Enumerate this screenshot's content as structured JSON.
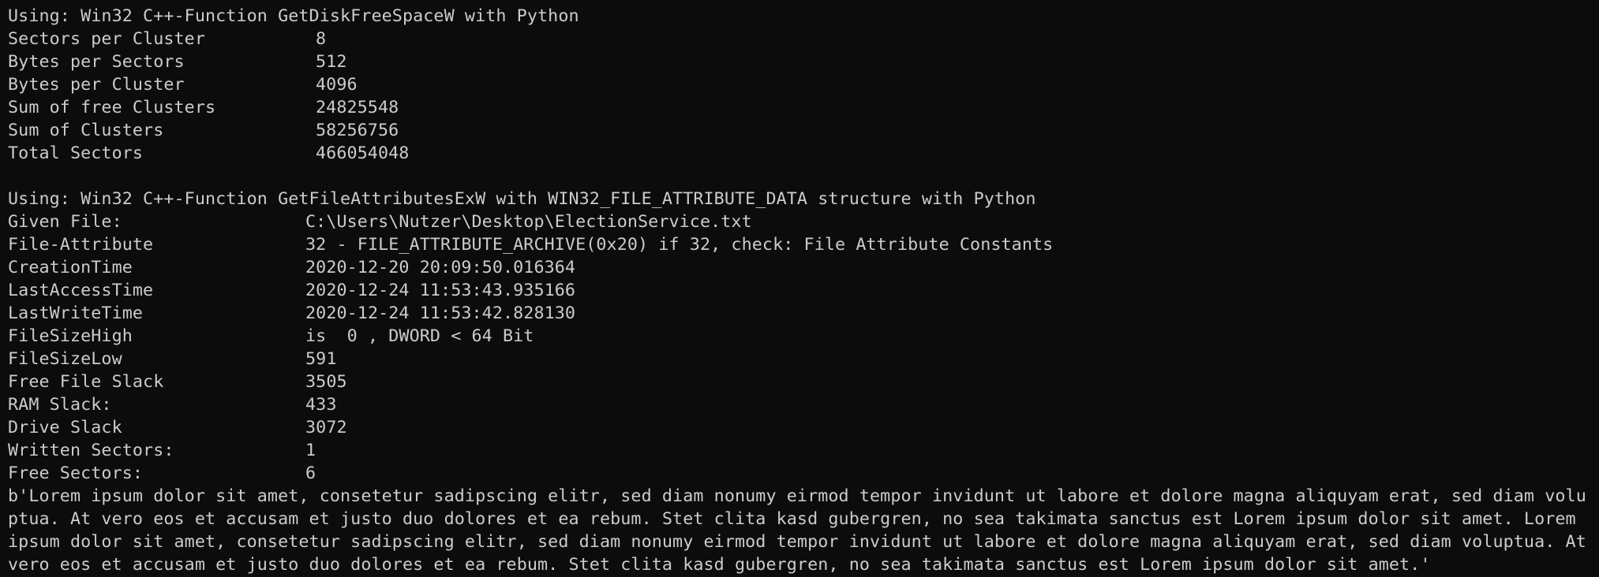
{
  "section1": {
    "heading": "Using: Win32 C++-Function GetDiskFreeSpaceW with Python",
    "rows": [
      {
        "label": "Sectors per Cluster",
        "value": "8"
      },
      {
        "label": "Bytes per Sectors",
        "value": "512"
      },
      {
        "label": "Bytes per Cluster",
        "value": "4096"
      },
      {
        "label": "Sum of free Clusters",
        "value": "24825548"
      },
      {
        "label": "Sum of Clusters",
        "value": "58256756"
      },
      {
        "label": "Total Sectors",
        "value": "466054048"
      }
    ]
  },
  "section2": {
    "heading": "Using: Win32 C++-Function GetFileAttributesExW with WIN32_FILE_ATTRIBUTE_DATA structure with Python",
    "rows": [
      {
        "label": "Given File:",
        "value": "C:\\Users\\Nutzer\\Desktop\\ElectionService.txt"
      },
      {
        "label": "File-Attribute",
        "value": "32 - FILE_ATTRIBUTE_ARCHIVE(0x20) if 32, check: File Attribute Constants"
      },
      {
        "label": "CreationTime",
        "value": "2020-12-20 20:09:50.016364"
      },
      {
        "label": "LastAccessTime",
        "value": "2020-12-24 11:53:43.935166"
      },
      {
        "label": "LastWriteTime",
        "value": "2020-12-24 11:53:42.828130"
      },
      {
        "label": "FileSizeHigh",
        "value": "is  0 , DWORD < 64 Bit"
      },
      {
        "label": "FileSizeLow",
        "value": "591"
      },
      {
        "label": "Free File Slack",
        "value": "3505"
      },
      {
        "label": "RAM Slack:",
        "value": "433"
      },
      {
        "label": "Drive Slack",
        "value": "3072"
      },
      {
        "label": "Written Sectors:",
        "value": "1"
      },
      {
        "label": "Free Sectors:",
        "value": "6"
      }
    ]
  },
  "file_content": "b'Lorem ipsum dolor sit amet, consetetur sadipscing elitr, sed diam nonumy eirmod tempor invidunt ut labore et dolore magna aliquyam erat, sed diam voluptua. At vero eos et accusam et justo duo dolores et ea rebum. Stet clita kasd gubergren, no sea takimata sanctus est Lorem ipsum dolor sit amet. Lorem ipsum dolor sit amet, consetetur sadipscing elitr, sed diam nonumy eirmod tempor invidunt ut labore et dolore magna aliquyam erat, sed diam voluptua. At vero eos et accusam et justo duo dolores et ea rebum. Stet clita kasd gubergren, no sea takimata sanctus est Lorem ipsum dolor sit amet.'"
}
